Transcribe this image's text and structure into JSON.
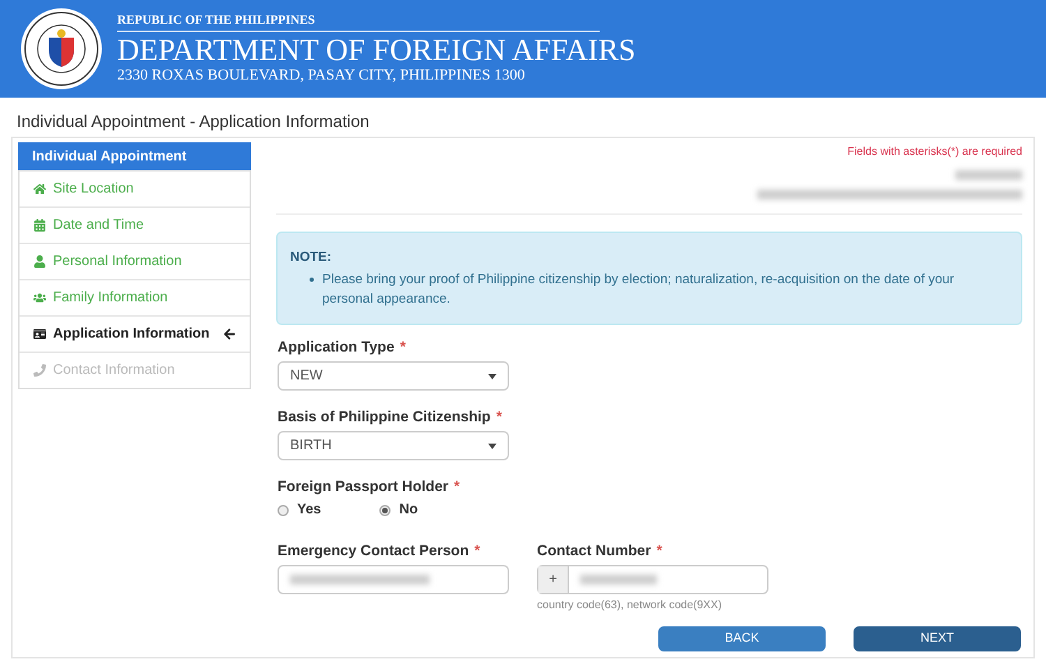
{
  "header": {
    "kicker": "REPUBLIC OF THE PHILIPPINES",
    "title": "DEPARTMENT OF FOREIGN AFFAIRS",
    "address": "2330 ROXAS BOULEVARD, PASAY CITY, PHILIPPINES 1300"
  },
  "page_title": "Individual Appointment - Application Information",
  "sidebar": {
    "title": "Individual Appointment",
    "items": [
      {
        "label": "Site Location",
        "completed": true,
        "selected": false,
        "disabled": false
      },
      {
        "label": "Date and Time",
        "completed": true,
        "selected": false,
        "disabled": false
      },
      {
        "label": "Personal Information",
        "completed": true,
        "selected": false,
        "disabled": false
      },
      {
        "label": "Family Information",
        "completed": true,
        "selected": false,
        "disabled": false
      },
      {
        "label": "Application Information",
        "completed": false,
        "selected": true,
        "disabled": false
      },
      {
        "label": "Contact Information",
        "completed": false,
        "selected": false,
        "disabled": true
      }
    ]
  },
  "required_note": "Fields with asterisks(*) are required",
  "note": {
    "title": "NOTE:",
    "items": [
      "Please bring your proof of Philippine citizenship by election; naturalization, re-acquisition on the date of your personal appearance."
    ]
  },
  "form": {
    "application_type": {
      "label": "Application Type",
      "required_mark": "*",
      "value": "NEW"
    },
    "citizenship_basis": {
      "label": "Basis of Philippine Citizenship",
      "required_mark": "*",
      "value": "BIRTH"
    },
    "foreign_passport": {
      "label": "Foreign Passport Holder",
      "required_mark": "*",
      "options": [
        {
          "label": "Yes",
          "selected": false
        },
        {
          "label": "No",
          "selected": true
        }
      ]
    },
    "emergency_contact": {
      "label": "Emergency Contact Person",
      "required_mark": "*"
    },
    "contact_number": {
      "label": "Contact Number",
      "required_mark": "*",
      "prefix": "+",
      "hint": "country code(63), network code(9XX)"
    }
  },
  "buttons": [
    {
      "label": "BACK",
      "kind": "back"
    },
    {
      "label": "NEXT",
      "kind": "next"
    }
  ]
}
